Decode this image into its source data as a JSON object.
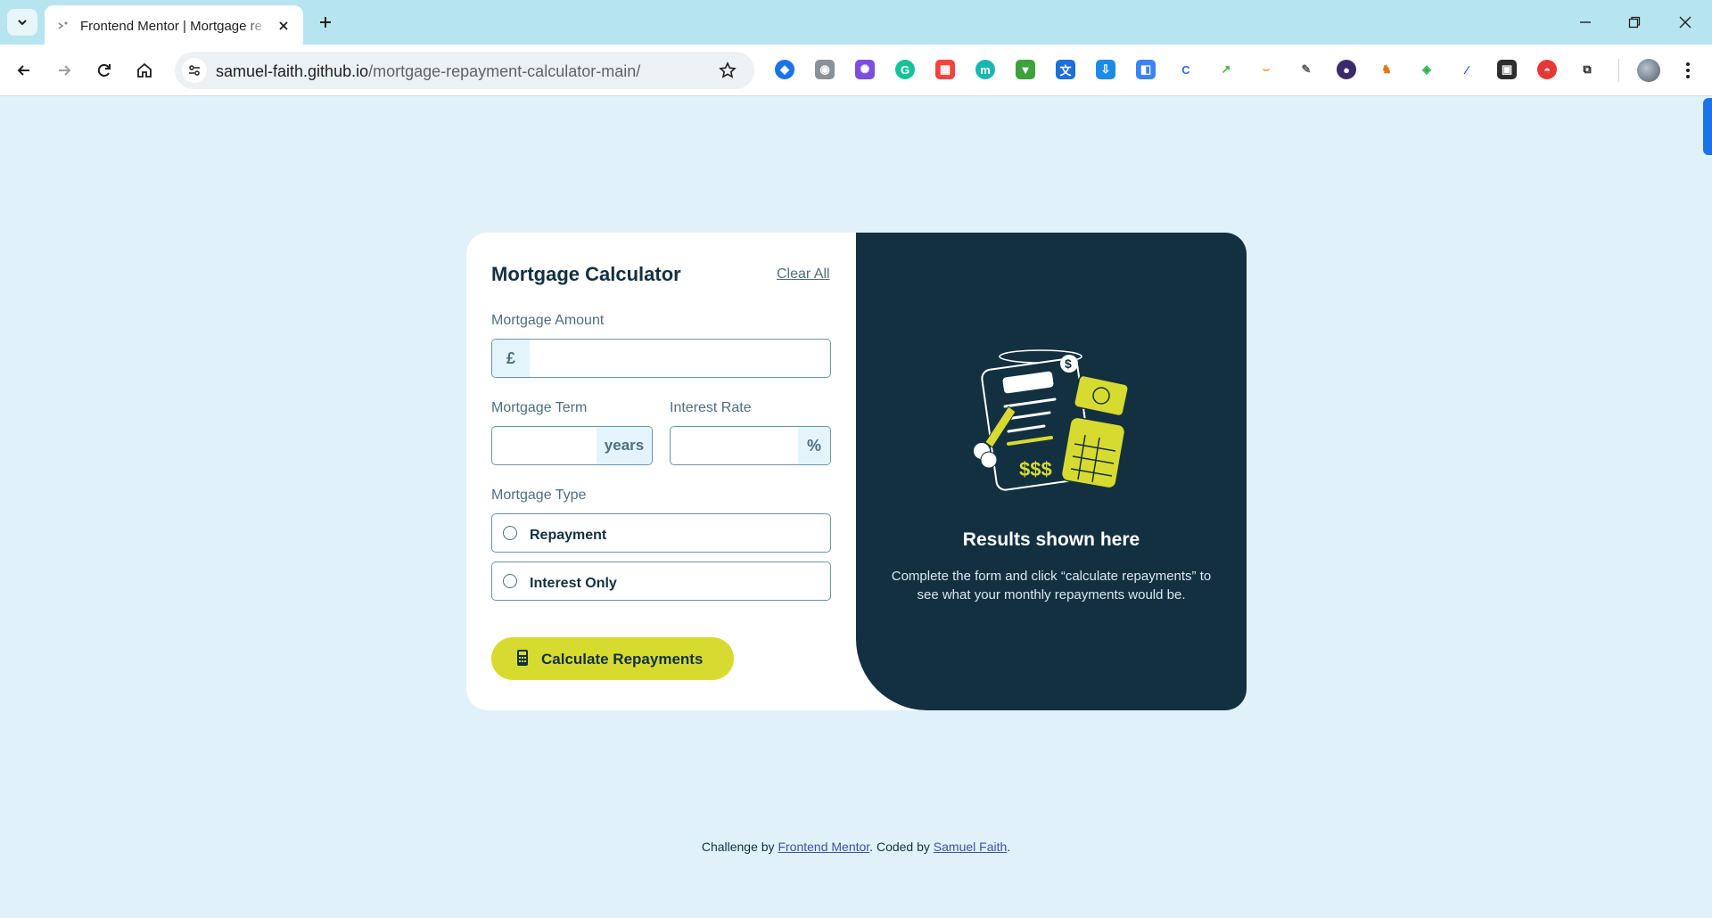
{
  "browser": {
    "tab_title": "Frontend Mentor | Mortgage re",
    "url_host": "samuel-faith.github.io",
    "url_path": "/mortgage-repayment-calculator-main/"
  },
  "calculator": {
    "title": "Mortgage Calculator",
    "clear_all": "Clear All",
    "amount_label": "Mortgage Amount",
    "amount_prefix": "£",
    "amount_value": "",
    "term_label": "Mortgage Term",
    "term_suffix": "years",
    "term_value": "",
    "rate_label": "Interest Rate",
    "rate_suffix": "%",
    "rate_value": "",
    "type_label": "Mortgage Type",
    "type_options": [
      {
        "label": "Repayment",
        "selected": false
      },
      {
        "label": "Interest Only",
        "selected": false
      }
    ],
    "submit_label": "Calculate Repayments"
  },
  "results": {
    "heading": "Results shown here",
    "description": "Complete the form and click “calculate repayments” to see what your monthly repayments would be."
  },
  "footer": {
    "prefix": "Challenge by",
    "link1": "Frontend Mentor",
    "middle": ". Coded by",
    "link2": "Samuel Faith",
    "suffix": "."
  },
  "colors": {
    "page_bg": "#e1f1fa",
    "card_bg": "#ffffff",
    "results_bg": "#133041",
    "accent_lime": "#d8db2f",
    "text_dark": "#133041",
    "text_muted": "#4e6e7e",
    "link": "#3e52a3"
  },
  "icons": {
    "extensions": [
      "drop-icon",
      "camera-icon",
      "gear-icon",
      "grammarly-icon",
      "app-icon",
      "m-icon",
      "download-arrow-icon",
      "translate-icon",
      "save-icon",
      "shape-icon",
      "c-icon",
      "chart-icon",
      "amazon-icon",
      "feather-icon",
      "circle-icon",
      "fox-icon",
      "diamond-icon",
      "pen-icon",
      "qr-icon",
      "pokeball-icon",
      "puzzle-icon"
    ]
  }
}
